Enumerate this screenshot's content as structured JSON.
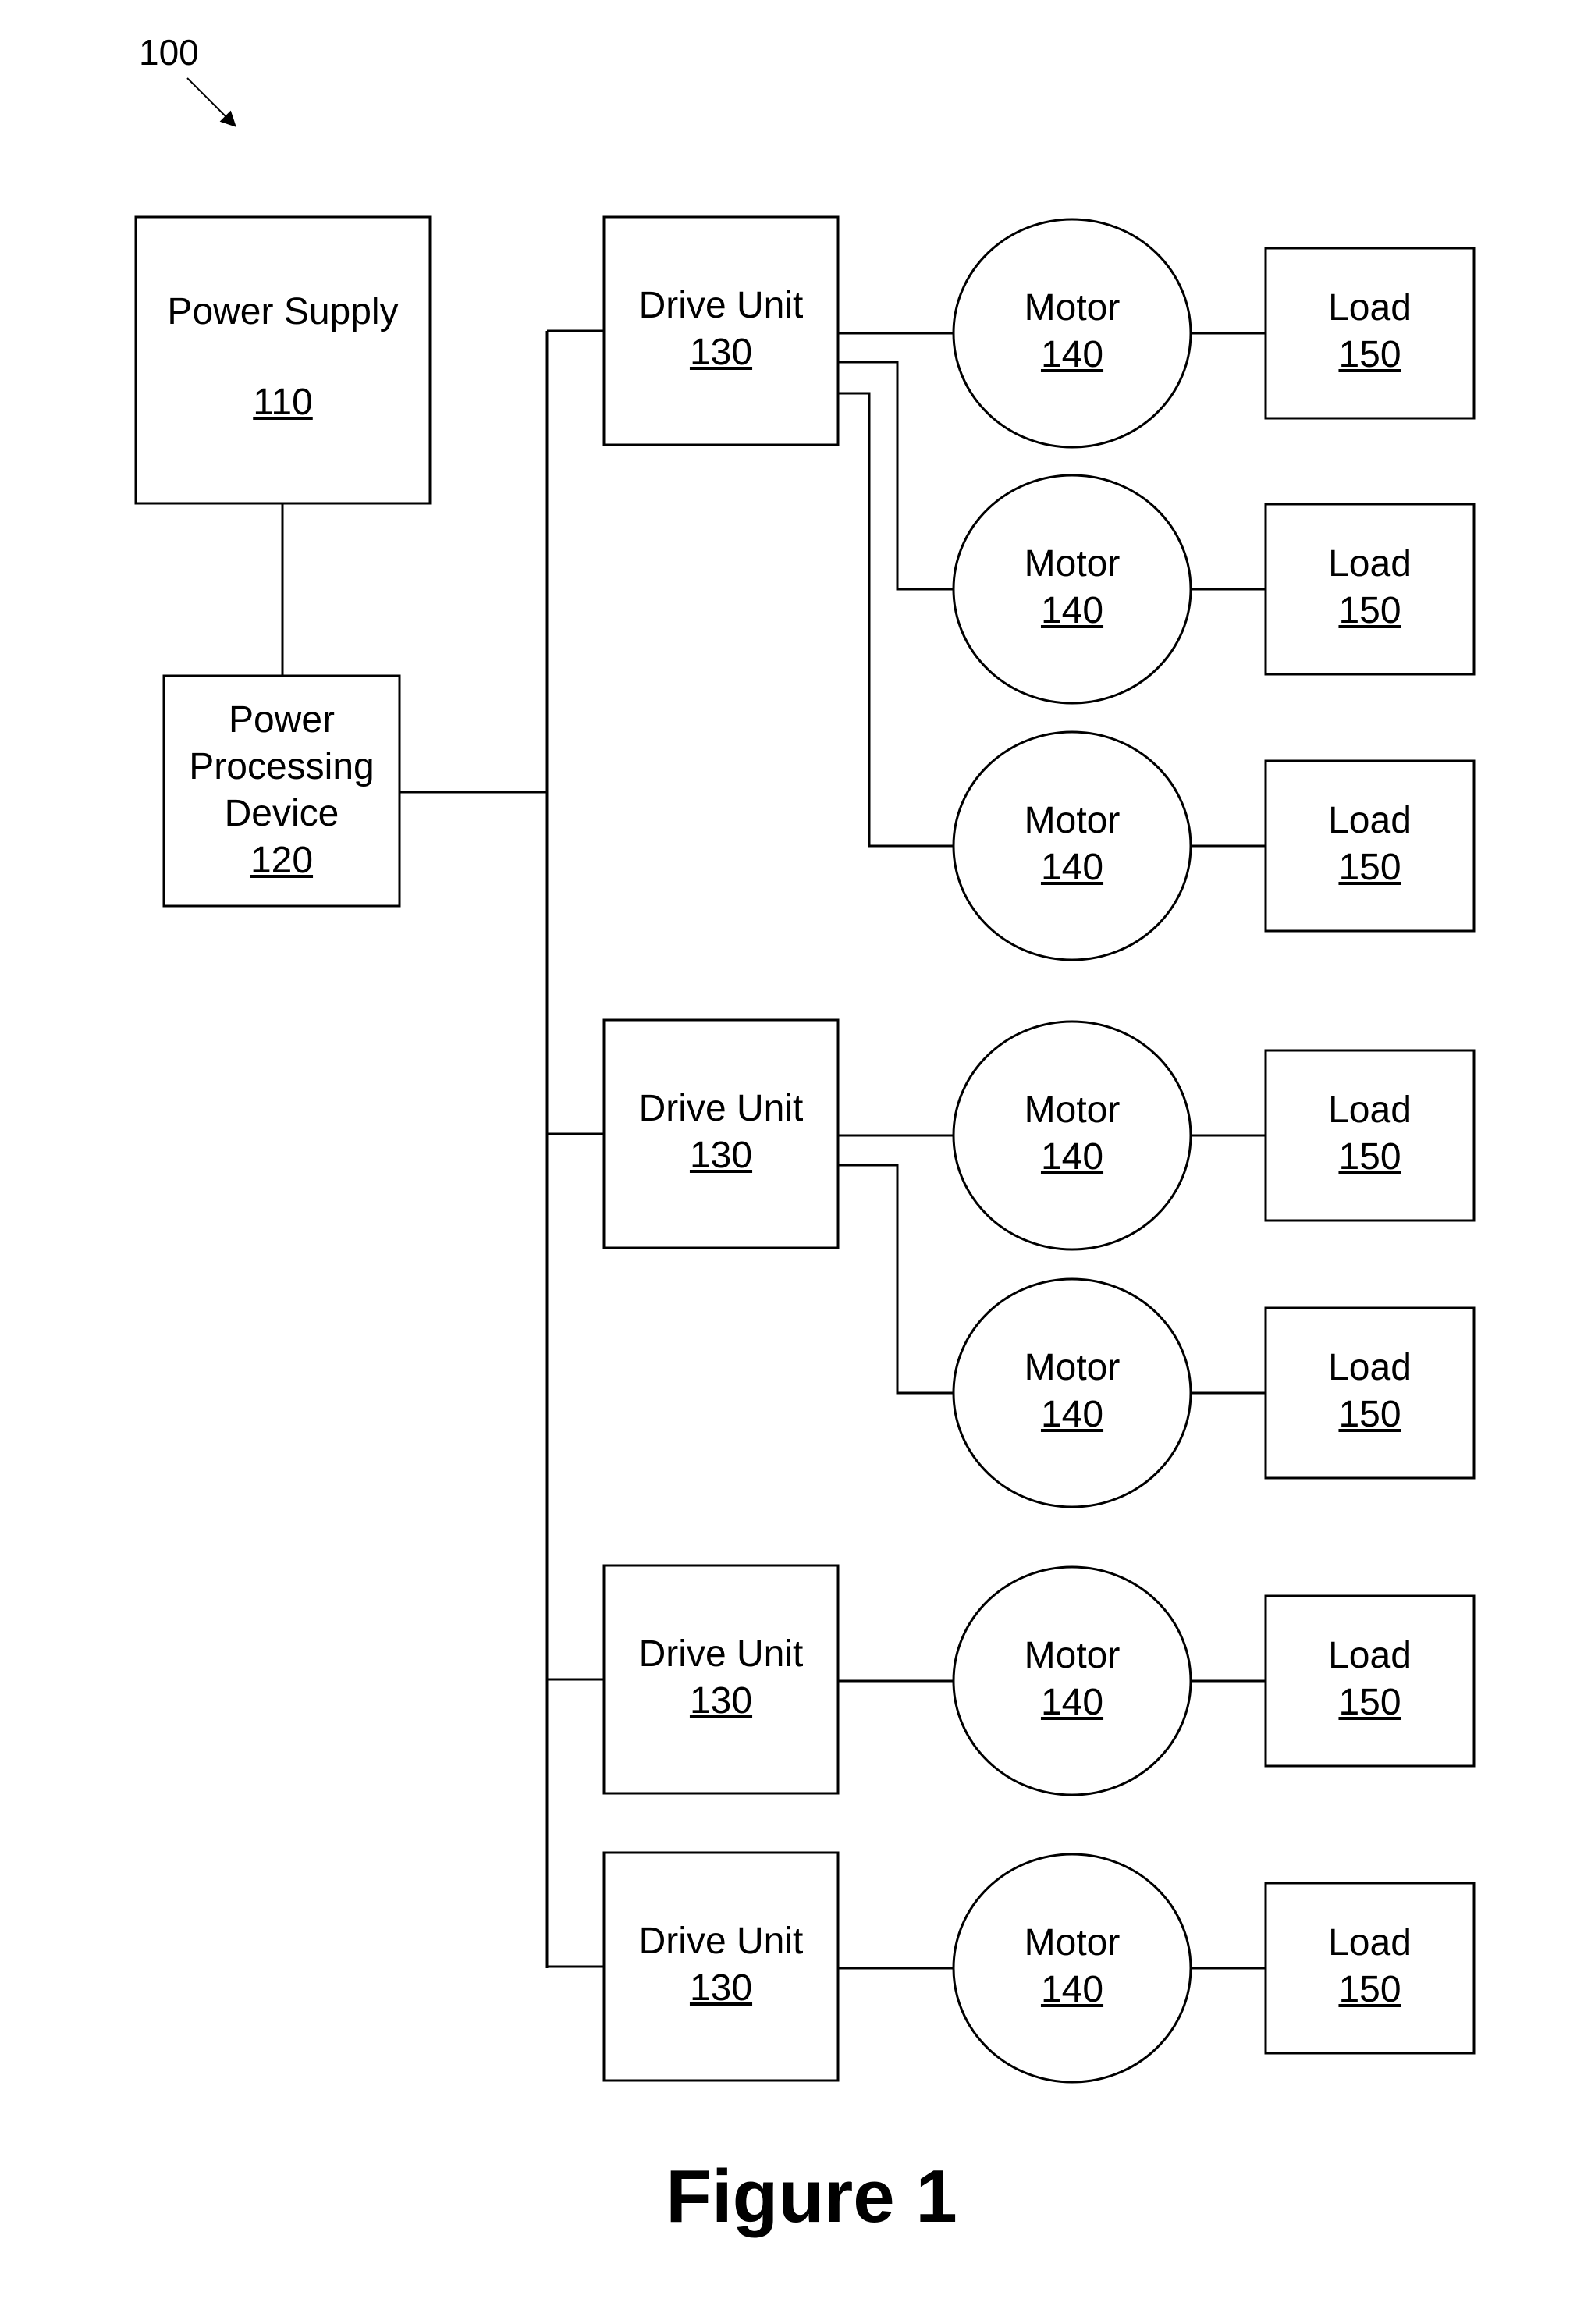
{
  "figure_ref": "100",
  "caption": "Figure 1",
  "power_supply": {
    "name": "Power Supply",
    "ref": "110"
  },
  "power_processing": {
    "name": [
      "Power",
      "Processing",
      "Device"
    ],
    "ref": "120"
  },
  "drive_units": [
    {
      "name": "Drive Unit",
      "ref": "130",
      "motors": 3
    },
    {
      "name": "Drive Unit",
      "ref": "130",
      "motors": 2
    },
    {
      "name": "Drive Unit",
      "ref": "130",
      "motors": 1
    },
    {
      "name": "Drive Unit",
      "ref": "130",
      "motors": 1
    }
  ],
  "motor": {
    "name": "Motor",
    "ref": "140"
  },
  "load": {
    "name": "Load",
    "ref": "150"
  }
}
